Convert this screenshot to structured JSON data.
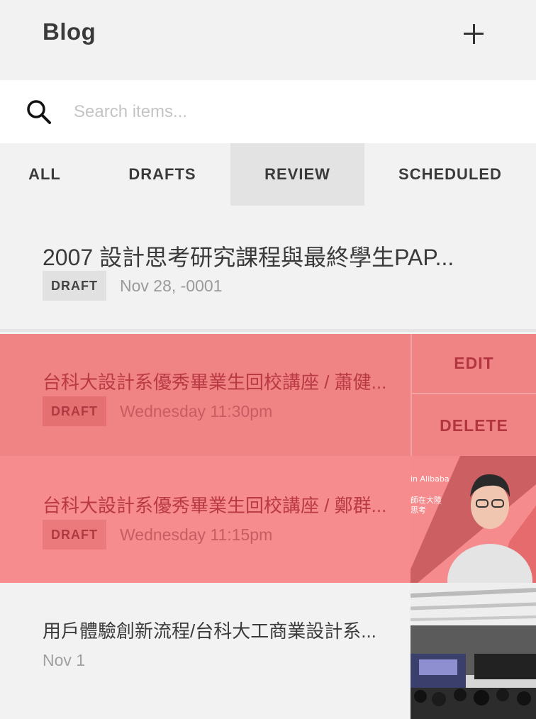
{
  "header": {
    "title": "Blog",
    "add_icon": "plus-icon"
  },
  "search": {
    "icon": "search-icon",
    "placeholder": "Search items..."
  },
  "tabs": [
    {
      "label": "ALL",
      "active": false
    },
    {
      "label": "DRAFTS",
      "active": false
    },
    {
      "label": "REVIEW",
      "active": true
    },
    {
      "label": "SCHEDULED",
      "active": false
    }
  ],
  "items": [
    {
      "title": "2007 設計思考研究課程與最終學生PAP...",
      "badge": "DRAFT",
      "time": "Nov 28, -0001",
      "highlight": false
    },
    {
      "title": "台科大設計系優秀畢業生回校講座 / 蕭健...",
      "badge": "DRAFT",
      "time": "Wednesday 11:30pm",
      "highlight": true,
      "actions": {
        "edit": "EDIT",
        "delete": "DELETE"
      }
    },
    {
      "title": "台科大設計系優秀畢業生回校講座 / 鄭群...",
      "badge": "DRAFT",
      "time": "Wednesday 11:15pm",
      "highlight": true,
      "thumbnail_text": [
        "in Alibaba",
        "師在大陸",
        "思考"
      ]
    },
    {
      "title": "用戶體驗創新流程/台科大工商業設計系...",
      "time": "Nov 1",
      "highlight": false
    }
  ],
  "colors": {
    "background": "#f2f2f2",
    "highlight_row": "#f08485",
    "highlight_row_alt": "#f68c8d",
    "accent_text": "#b93a43",
    "active_tab": "#e3e3e3"
  }
}
